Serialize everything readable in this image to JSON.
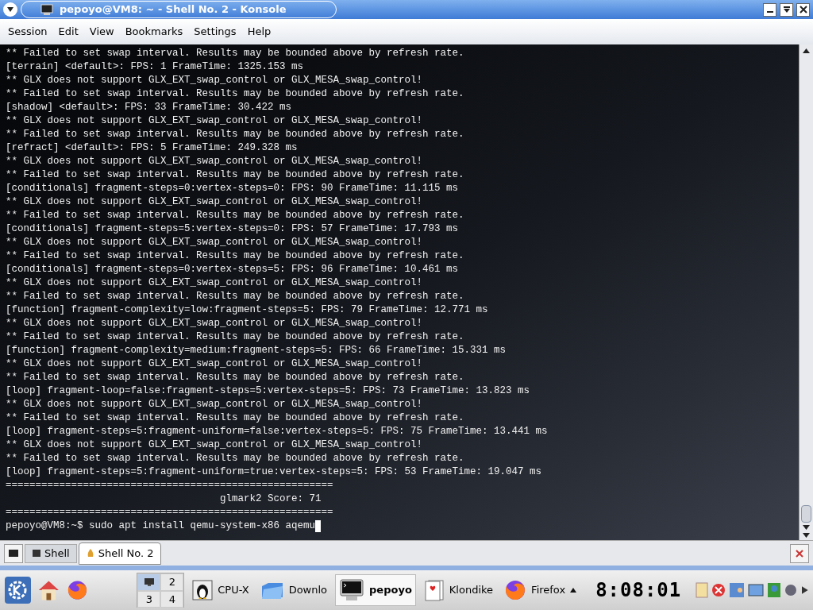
{
  "window": {
    "title": "pepoyo@VM8: ~ - Shell No. 2 - Konsole"
  },
  "menu": [
    "Session",
    "Edit",
    "View",
    "Bookmarks",
    "Settings",
    "Help"
  ],
  "terminal": {
    "lines": [
      "** Failed to set swap interval. Results may be bounded above by refresh rate.",
      "[terrain] <default>: FPS: 1 FrameTime: 1325.153 ms",
      "** GLX does not support GLX_EXT_swap_control or GLX_MESA_swap_control!",
      "** Failed to set swap interval. Results may be bounded above by refresh rate.",
      "[shadow] <default>: FPS: 33 FrameTime: 30.422 ms",
      "** GLX does not support GLX_EXT_swap_control or GLX_MESA_swap_control!",
      "** Failed to set swap interval. Results may be bounded above by refresh rate.",
      "[refract] <default>: FPS: 5 FrameTime: 249.328 ms",
      "** GLX does not support GLX_EXT_swap_control or GLX_MESA_swap_control!",
      "** Failed to set swap interval. Results may be bounded above by refresh rate.",
      "[conditionals] fragment-steps=0:vertex-steps=0: FPS: 90 FrameTime: 11.115 ms",
      "** GLX does not support GLX_EXT_swap_control or GLX_MESA_swap_control!",
      "** Failed to set swap interval. Results may be bounded above by refresh rate.",
      "[conditionals] fragment-steps=5:vertex-steps=0: FPS: 57 FrameTime: 17.793 ms",
      "** GLX does not support GLX_EXT_swap_control or GLX_MESA_swap_control!",
      "** Failed to set swap interval. Results may be bounded above by refresh rate.",
      "[conditionals] fragment-steps=0:vertex-steps=5: FPS: 96 FrameTime: 10.461 ms",
      "** GLX does not support GLX_EXT_swap_control or GLX_MESA_swap_control!",
      "** Failed to set swap interval. Results may be bounded above by refresh rate.",
      "[function] fragment-complexity=low:fragment-steps=5: FPS: 79 FrameTime: 12.771 ms",
      "** GLX does not support GLX_EXT_swap_control or GLX_MESA_swap_control!",
      "** Failed to set swap interval. Results may be bounded above by refresh rate.",
      "[function] fragment-complexity=medium:fragment-steps=5: FPS: 66 FrameTime: 15.331 ms",
      "** GLX does not support GLX_EXT_swap_control or GLX_MESA_swap_control!",
      "** Failed to set swap interval. Results may be bounded above by refresh rate.",
      "[loop] fragment-loop=false:fragment-steps=5:vertex-steps=5: FPS: 73 FrameTime: 13.823 ms",
      "** GLX does not support GLX_EXT_swap_control or GLX_MESA_swap_control!",
      "** Failed to set swap interval. Results may be bounded above by refresh rate.",
      "[loop] fragment-steps=5:fragment-uniform=false:vertex-steps=5: FPS: 75 FrameTime: 13.441 ms",
      "** GLX does not support GLX_EXT_swap_control or GLX_MESA_swap_control!",
      "** Failed to set swap interval. Results may be bounded above by refresh rate.",
      "[loop] fragment-steps=5:fragment-uniform=true:vertex-steps=5: FPS: 53 FrameTime: 19.047 ms",
      "=======================================================",
      "                                    glmark2 Score: 71",
      "======================================================="
    ],
    "prompt": "pepoyo@VM8:~$ sudo apt install qemu-system-x86 aqemu"
  },
  "tabs": [
    {
      "label": "Shell",
      "selected": false
    },
    {
      "label": "Shell No. 2",
      "selected": true
    }
  ],
  "taskbar": {
    "pager": [
      {
        "selected": true
      },
      {
        "label": "2",
        "selected": false
      },
      {
        "label": "3",
        "selected": false
      },
      {
        "label": "4",
        "selected": false
      }
    ],
    "tasks": [
      {
        "label": "CPU-X",
        "kind": "penguin",
        "active": false
      },
      {
        "label": "Downlo",
        "kind": "folder",
        "active": false
      },
      {
        "label": "pepoyo",
        "kind": "terminal",
        "active": true
      },
      {
        "label": "Klondike",
        "kind": "cards",
        "active": false
      },
      {
        "label": "Firefox",
        "kind": "browser",
        "active": false,
        "grouped": true
      }
    ],
    "clock": "8:08:01"
  }
}
